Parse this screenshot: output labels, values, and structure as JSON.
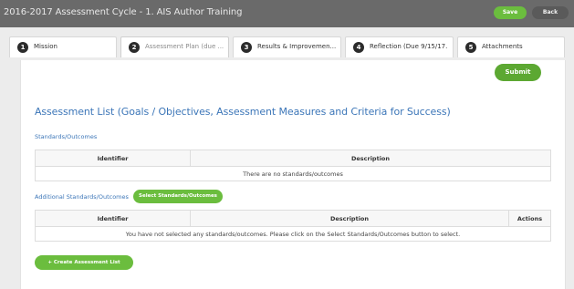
{
  "header": {
    "title": "2016-2017 Assessment Cycle - 1. AIS Author Training",
    "save_label": "Save",
    "back_label": "Back"
  },
  "tabs": [
    {
      "number": "1",
      "label": "Mission"
    },
    {
      "number": "2",
      "label": "Assessment Plan (due ..."
    },
    {
      "number": "3",
      "label": "Results & Improvemen..."
    },
    {
      "number": "4",
      "label": "Reflection (Due 9/15/17..."
    },
    {
      "number": "5",
      "label": "Attachments"
    }
  ],
  "submit_label": "Submit",
  "main": {
    "heading": "Assessment List (Goals / Objectives, Assessment Measures and Criteria for Success)",
    "standards_link": "Standards/Outcomes",
    "standards_table": {
      "columns": [
        "Identifier",
        "Description"
      ],
      "empty_message": "There are no standards/outcomes"
    },
    "additional_label": "Additional Standards/Outcomes",
    "select_button_label": "Select Standards/Outcomes",
    "selected_table": {
      "columns": [
        "Identifier",
        "Description",
        "Actions"
      ],
      "empty_message": "You have not selected any standards/outcomes. Please click on the Select Standards/Outcomes button to select."
    },
    "create_button_label": "+ Create Assessment List"
  },
  "colors": {
    "header_bg": "#6a6a6a",
    "accent_green": "#6bbd3e",
    "link_blue": "#3c76b8"
  }
}
